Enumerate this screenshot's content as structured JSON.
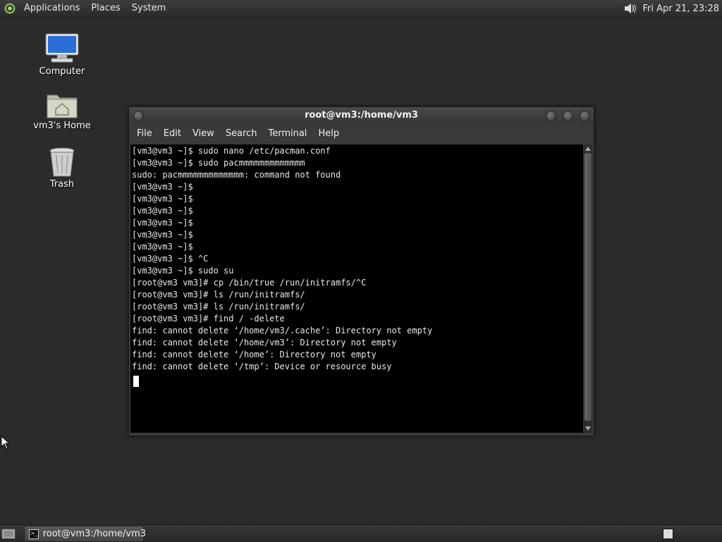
{
  "top_panel": {
    "menus": [
      "Applications",
      "Places",
      "System"
    ],
    "clock": "Fri Apr 21, 23:28"
  },
  "desktop": {
    "icons": [
      {
        "label": "Computer"
      },
      {
        "label": "vm3's Home"
      },
      {
        "label": "Trash"
      }
    ]
  },
  "terminal": {
    "title": "root@vm3:/home/vm3",
    "menu": [
      "File",
      "Edit",
      "View",
      "Search",
      "Terminal",
      "Help"
    ],
    "lines": [
      "[vm3@vm3 ~]$ sudo nano /etc/pacman.conf",
      "[vm3@vm3 ~]$ sudo pacmmmmmmmmmmmmm",
      "sudo: pacmmmmmmmmmmmmm: command not found",
      "[vm3@vm3 ~]$",
      "[vm3@vm3 ~]$",
      "[vm3@vm3 ~]$",
      "[vm3@vm3 ~]$",
      "[vm3@vm3 ~]$",
      "[vm3@vm3 ~]$",
      "[vm3@vm3 ~]$ ^C",
      "[vm3@vm3 ~]$ sudo su",
      "[root@vm3 vm3]# cp /bin/true /run/initramfs/^C",
      "[root@vm3 vm3]# ls /run/initramfs/",
      "[root@vm3 vm3]# ls /run/initramfs/",
      "[root@vm3 vm3]# find / -delete",
      "find: cannot delete ‘/home/vm3/.cache’: Directory not empty",
      "find: cannot delete ‘/home/vm3’: Directory not empty",
      "find: cannot delete ‘/home’: Directory not empty",
      "find: cannot delete ‘/tmp’: Device or resource busy"
    ]
  },
  "taskbar": {
    "task_label": "root@vm3:/home/vm3"
  },
  "colors": {
    "desktop_bg": "#2b2b2b",
    "terminal_bg": "#000000",
    "terminal_fg": "#e8e8e8"
  }
}
